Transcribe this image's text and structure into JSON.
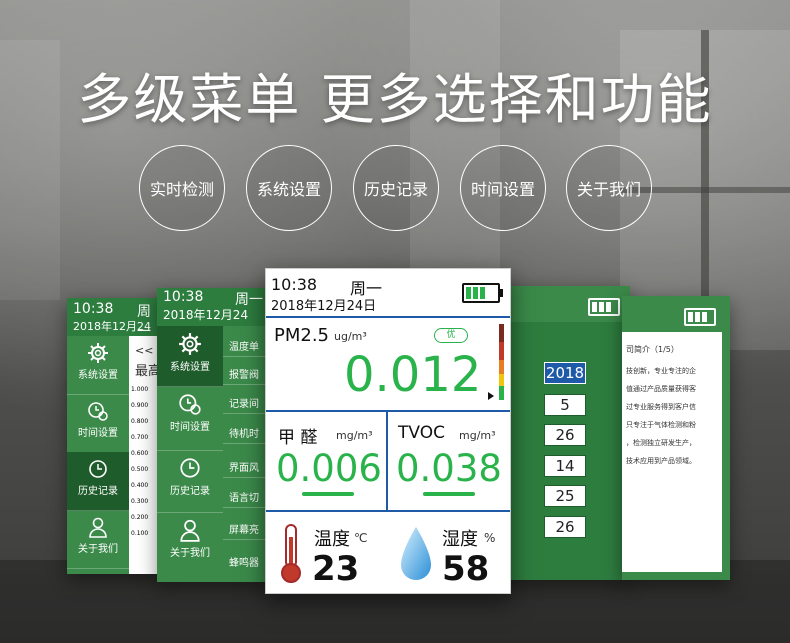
{
  "headline": "多级菜单 更多选择和功能",
  "features": [
    "实时检测",
    "系统设置",
    "历史记录",
    "时间设置",
    "关于我们"
  ],
  "status": {
    "time": "10:38",
    "weekday": "周一",
    "weekday_short": "周一",
    "date": "2018年12月24日",
    "date_short": "2018年12月24"
  },
  "sidebar": [
    "系统设置",
    "时间设置",
    "历史记录",
    "关于我们"
  ],
  "history": {
    "crumb": "<<",
    "max_label": "最高",
    "ticks": [
      "1.000",
      "0.900",
      "0.800",
      "0.700",
      "0.600",
      "0.500",
      "0.400",
      "0.300",
      "0.200",
      "0.100"
    ]
  },
  "settings_menu": [
    "温度单",
    "报警阀",
    "记录间",
    "待机时",
    "界面风",
    "语言切",
    "屏幕亮",
    "蜂鸣器"
  ],
  "years": [
    "2018",
    "5",
    "26",
    "14",
    "25",
    "26"
  ],
  "about": {
    "title": "司简介（1/5）",
    "lines": [
      "技创新，专业专注的企",
      "值通过产品质量获得客",
      "过专业服务得到客户信",
      "只专注于气体检测和粉",
      "，检测独立研发生产，",
      "技术应用到产品领域。"
    ]
  },
  "main": {
    "pm_label": "PM2.5",
    "pm_unit": "ug/m³",
    "pm_badge": "优",
    "pm_value": "0.012",
    "hcho_label": "甲  醛",
    "hcho_unit": "mg/m³",
    "hcho_value": "0.006",
    "tvoc_label": "TVOC",
    "tvoc_unit": "mg/m³",
    "tvoc_value": "0.038",
    "temp_label": "温度",
    "temp_unit": "℃",
    "temp_value": "23",
    "hum_label": "湿度",
    "hum_unit": "%",
    "hum_value": "58",
    "battery_level": 1.0
  },
  "colors": {
    "green": "#29b34a",
    "panel_green": "#2d7d3f",
    "divider_blue": "#1e5aa8"
  }
}
